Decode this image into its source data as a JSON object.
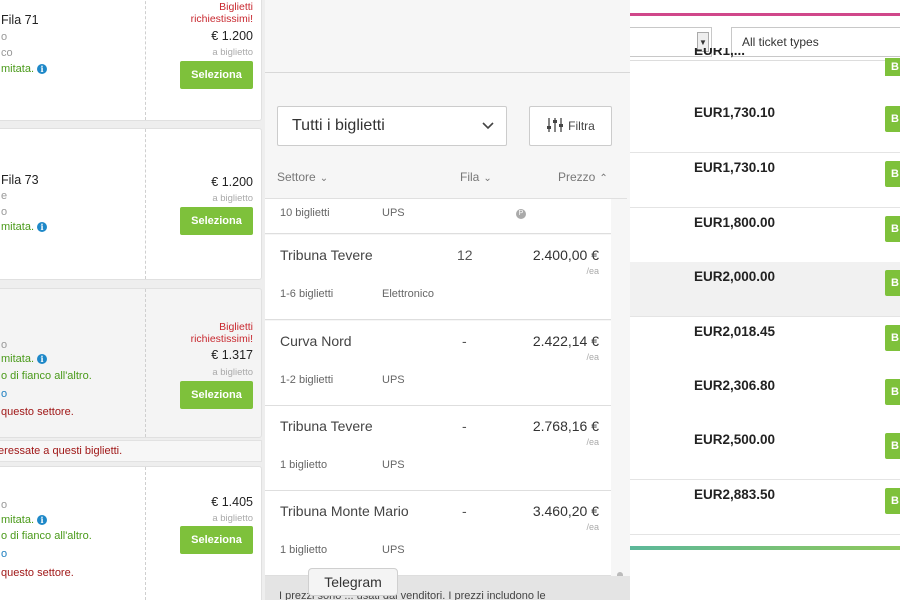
{
  "left": {
    "cards": [
      {
        "title": "Fila 71",
        "sub": "o",
        "sub2": "co",
        "green": "mitata.",
        "hot": [
          "Biglietti",
          "richiestissimi!"
        ],
        "price": "€ 1.200",
        "per": "a biglietto",
        "button": "Seleziona"
      },
      {
        "title": "Fila 73",
        "sub": "e",
        "sub2": "o",
        "green": "mitata.",
        "price": "€ 1.200",
        "per": "a biglietto",
        "button": "Seleziona"
      },
      {
        "sub": "o",
        "green": "mitata.",
        "green2": "o di fianco all'altro.",
        "blue": "o",
        "red": "questo settore.",
        "hot": [
          "Biglietti",
          "richiestissimi!"
        ],
        "price": "€ 1.317",
        "per": "a biglietto",
        "button": "Seleziona"
      },
      {
        "sub": "o",
        "green": "mitata.",
        "green2": "o di fianco all'altro.",
        "blue": "o",
        "red": "questo settore.",
        "price": "€ 1.405",
        "per": "a biglietto",
        "button": "Seleziona"
      }
    ],
    "notice": "teressate a questi biglietti."
  },
  "middle": {
    "dropdown": "Tutti i biglietti",
    "filter": "Filtra",
    "headers": {
      "sector": "Settore",
      "row": "Fila",
      "price": "Prezzo"
    },
    "partial_row": {
      "qty": "10 biglietti",
      "delivery": "UPS",
      "icon": "P"
    },
    "listings": [
      {
        "sector": "Tribuna Tevere",
        "row": "12",
        "price": "2.400,00 €",
        "each": "/ea",
        "qty": "1-6 biglietti",
        "delivery": "Elettronico"
      },
      {
        "sector": "Curva Nord",
        "row": "-",
        "price": "2.422,14 €",
        "each": "/ea",
        "qty": "1-2 biglietti",
        "delivery": "UPS"
      },
      {
        "sector": "Tribuna Tevere",
        "row": "-",
        "price": "2.768,16 €",
        "each": "/ea",
        "qty": "1 biglietto",
        "delivery": "UPS"
      },
      {
        "sector": "Tribuna Monte Mario",
        "row": "-",
        "price": "3.460,20 €",
        "each": "/ea",
        "qty": "1 biglietto",
        "delivery": "UPS"
      }
    ],
    "footer": "I prezzi sono ... usati dai venditori. I prezzi includono le",
    "telegram": "Telegram"
  },
  "right": {
    "ticket_type_select": "All ticket types",
    "top_partial_price": "EUR1,...",
    "button_letter": "B",
    "prices": [
      "EUR1,730.10",
      "EUR1,730.10",
      "EUR1,800.00",
      "EUR2,000.00",
      "EUR2,018.45",
      "EUR2,306.80",
      "EUR2,500.00",
      "EUR2,883.50"
    ],
    "colors": {
      "accent_green": "#7ec13b",
      "pink": "#d0478a"
    }
  }
}
